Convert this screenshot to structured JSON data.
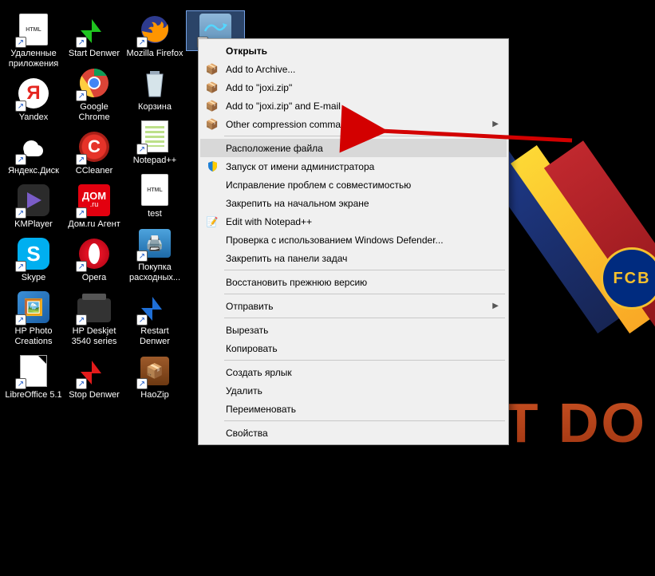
{
  "wallpaper": {
    "fcb_text": "FCB",
    "slogan": "JUST DO"
  },
  "desktop_columns": {
    "c1": [
      {
        "id": "deleted-apps",
        "label": "Удаленные приложения"
      },
      {
        "id": "yandex",
        "label": "Yandex"
      },
      {
        "id": "yandexdisk",
        "label": "Яндекс.Диск"
      },
      {
        "id": "kmplayer",
        "label": "KMPlayer"
      },
      {
        "id": "skype",
        "label": "Skype"
      },
      {
        "id": "hpphoto",
        "label": "HP Photo Creations"
      },
      {
        "id": "libreoffice",
        "label": "LibreOffice 5.1"
      }
    ],
    "c2": [
      {
        "id": "startdenwer",
        "label": "Start Denwer"
      },
      {
        "id": "chrome",
        "label": "Google Chrome"
      },
      {
        "id": "ccleaner",
        "label": "CCleaner"
      },
      {
        "id": "domru",
        "label": "Дом.ru Агент"
      },
      {
        "id": "opera",
        "label": "Opera"
      },
      {
        "id": "hpdeskjet",
        "label": "HP Deskjet 3540 series"
      },
      {
        "id": "stopdenwer",
        "label": "Stop Denwer"
      }
    ],
    "c3": [
      {
        "id": "firefox",
        "label": "Mozilla Firefox"
      },
      {
        "id": "recyclebin",
        "label": "Корзина"
      },
      {
        "id": "notepadpp",
        "label": "Notepad++"
      },
      {
        "id": "test",
        "label": "test"
      },
      {
        "id": "rashod",
        "label": "Покупка расходных..."
      },
      {
        "id": "restartdenwer",
        "label": "Restart Denwer"
      },
      {
        "id": "haozip",
        "label": "HaoZip"
      }
    ],
    "c4": [
      {
        "id": "joxi",
        "label": ""
      }
    ]
  },
  "context_menu": {
    "highlighted": "location",
    "items": [
      {
        "id": "open",
        "label": "Открыть",
        "bold": true
      },
      {
        "id": "archive",
        "label": "Add to Archive...",
        "icon": "archive"
      },
      {
        "id": "joxizip",
        "label": "Add to \"joxi.zip\"",
        "icon": "archive"
      },
      {
        "id": "joxizipemail",
        "label": "Add to \"joxi.zip\" and E-mail",
        "icon": "archive"
      },
      {
        "id": "othercomp",
        "label": "Other compression commands",
        "icon": "archive",
        "submenu": true
      },
      {
        "sep": true
      },
      {
        "id": "location",
        "label": "Расположение файла"
      },
      {
        "id": "runasadmin",
        "label": "Запуск от имени администратора",
        "icon": "shield"
      },
      {
        "id": "compat",
        "label": "Исправление проблем с совместимостью"
      },
      {
        "id": "pinstart",
        "label": "Закрепить на начальном экране"
      },
      {
        "id": "editnpp",
        "label": "Edit with Notepad++",
        "icon": "notepad"
      },
      {
        "id": "defender",
        "label": "Проверка с использованием Windows Defender..."
      },
      {
        "id": "pintaskbar",
        "label": "Закрепить на панели задач"
      },
      {
        "sep": true
      },
      {
        "id": "restore",
        "label": "Восстановить прежнюю версию"
      },
      {
        "sep": true
      },
      {
        "id": "sendto",
        "label": "Отправить",
        "submenu": true
      },
      {
        "sep": true
      },
      {
        "id": "cut",
        "label": "Вырезать"
      },
      {
        "id": "copy",
        "label": "Копировать"
      },
      {
        "sep": true
      },
      {
        "id": "shortcut",
        "label": "Создать ярлык"
      },
      {
        "id": "delete",
        "label": "Удалить"
      },
      {
        "id": "rename",
        "label": "Переименовать"
      },
      {
        "sep": true
      },
      {
        "id": "props",
        "label": "Свойства"
      }
    ]
  }
}
